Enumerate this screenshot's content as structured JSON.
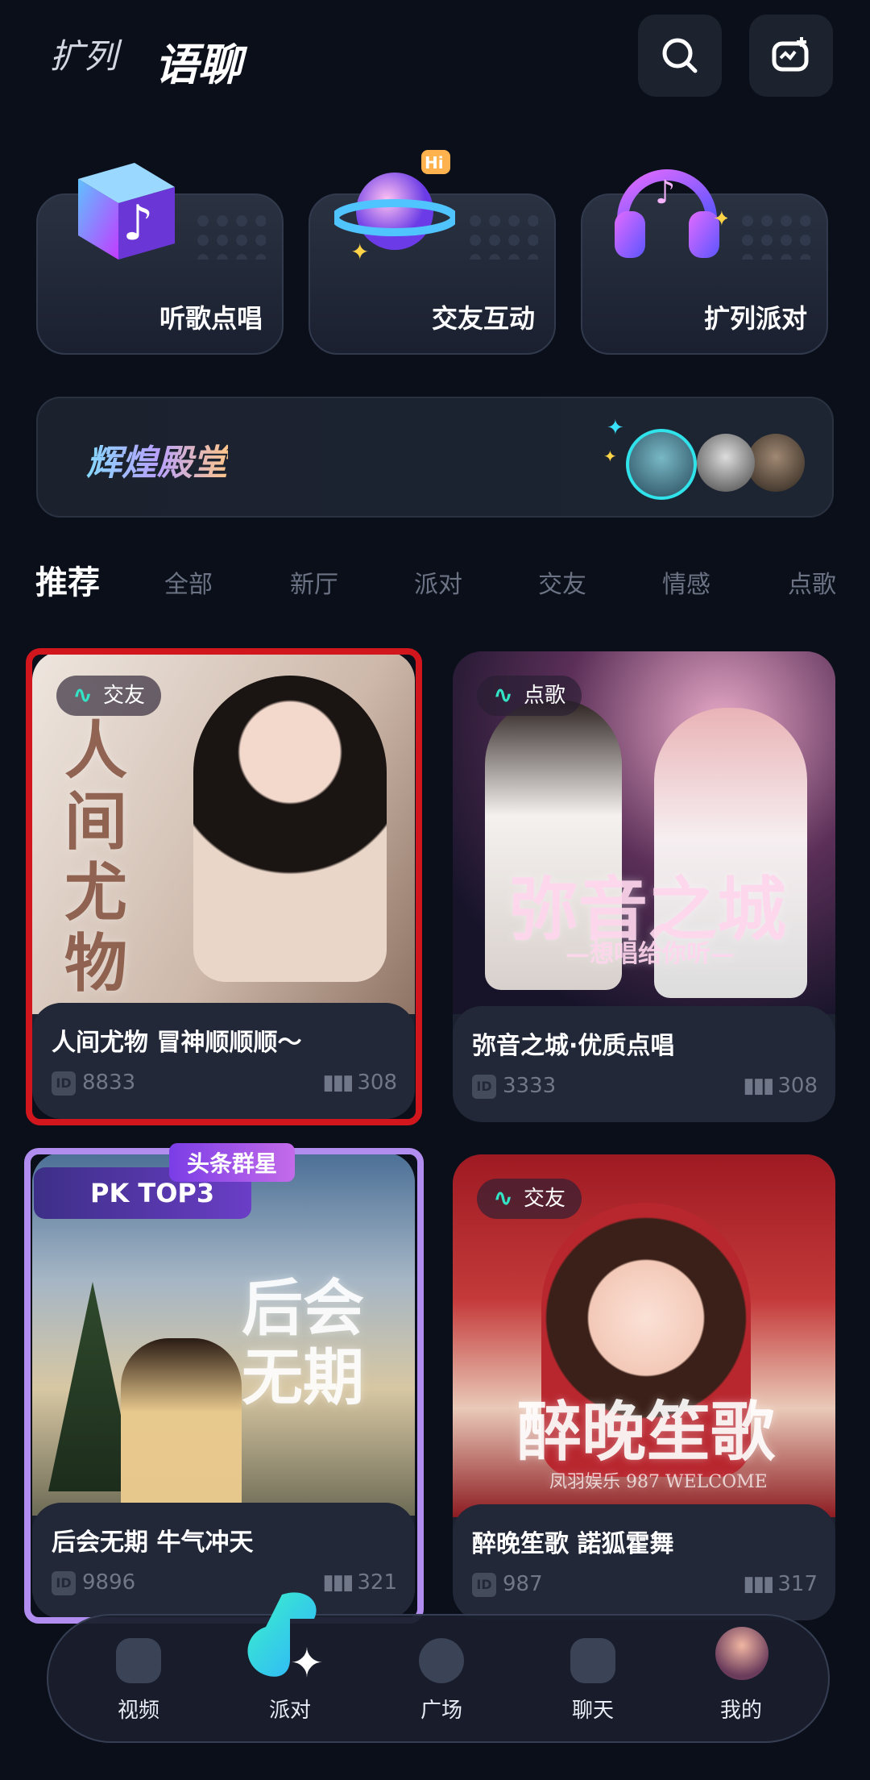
{
  "header": {
    "tab_expand": "扩列",
    "tab_voice": "语聊"
  },
  "categories": [
    {
      "label": "听歌点唱"
    },
    {
      "label": "交友互动"
    },
    {
      "label": "扩列派对"
    }
  ],
  "banner": {
    "title": "辉煌殿堂"
  },
  "filters": [
    "推荐",
    "全部",
    "新厅",
    "派对",
    "交友",
    "情感",
    "点歌"
  ],
  "rooms": [
    {
      "tag": "交友",
      "cover_text": "人间尤物",
      "name": "人间尤物 冒神顺顺顺～",
      "id": "8833",
      "count": "308",
      "colors": {
        "bg1": "#e9e1da",
        "bg2": "#b79d8d"
      }
    },
    {
      "tag": "点歌",
      "cover_text": "弥音之城",
      "cover_sub": "—想唱给你听—",
      "name": "弥音之城·优质点唱",
      "id": "3333",
      "count": "308",
      "colors": {
        "bg1": "#2c1f3a",
        "bg2": "#a86d8f"
      }
    },
    {
      "tag": "",
      "cover_text": "后会无期",
      "pk_label": "PK TOP3",
      "pk_top": "头条群星",
      "name": "后会无期 牛气冲天",
      "id": "9896",
      "count": "321",
      "colors": {
        "bg1": "#6d8fb2",
        "bg2": "#c7b38a"
      }
    },
    {
      "tag": "交友",
      "cover_text": "醉晚笙歌",
      "cover_sub": "凤羽娱乐 987 WELCOME",
      "name": "醉晚笙歌 諾狐霍舞",
      "id": "987",
      "count": "317",
      "colors": {
        "bg1": "#b3252c",
        "bg2": "#f1d3c4"
      }
    }
  ],
  "nav": {
    "items": [
      "视频",
      "派对",
      "广场",
      "聊天",
      "我的"
    ]
  },
  "id_label": "ID",
  "colors": {
    "accent_cyan": "#34e0ff",
    "accent_green": "#2bf4c5",
    "background": "#0b0f1a"
  }
}
